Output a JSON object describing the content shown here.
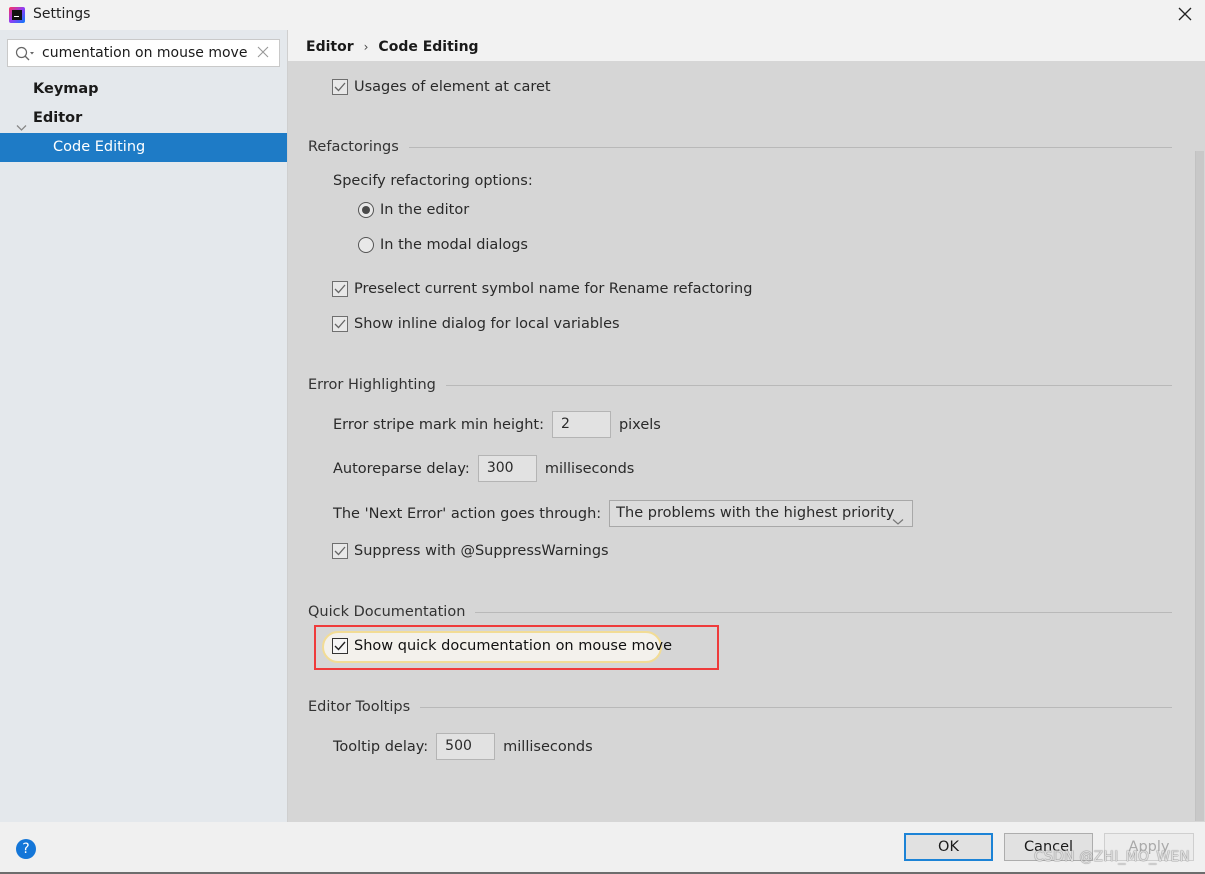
{
  "window": {
    "title": "Settings",
    "app_icon": "intellij-idea-icon",
    "close_icon": "close-icon"
  },
  "sidebar": {
    "search": {
      "value": "Show quick documentation on mouse move",
      "visible_text": "cumentation on mouse move",
      "icon": "search-icon",
      "clear_icon": "clear-icon"
    },
    "items": [
      {
        "label": "Keymap",
        "bold": true,
        "level": 0
      },
      {
        "label": "Editor",
        "bold": true,
        "level": 0,
        "expanded": true
      },
      {
        "label": "Code Editing",
        "bold": false,
        "level": 1,
        "selected": true
      }
    ]
  },
  "breadcrumb": {
    "parts": [
      "Editor",
      "Code Editing"
    ],
    "separator": "›"
  },
  "content": {
    "usages_checkbox": {
      "label": "Usages of element at caret",
      "checked": true
    },
    "refactorings": {
      "title": "Refactorings",
      "specify_label": "Specify refactoring options:",
      "radios": [
        {
          "label": "In the editor",
          "selected": true
        },
        {
          "label": "In the modal dialogs",
          "selected": false
        }
      ],
      "checkboxes": [
        {
          "label": "Preselect current symbol name for Rename refactoring",
          "checked": true
        },
        {
          "label": "Show inline dialog for local variables",
          "checked": true
        }
      ]
    },
    "error_highlighting": {
      "title": "Error Highlighting",
      "stripe": {
        "label": "Error stripe mark min height:",
        "value": "2",
        "unit": "pixels"
      },
      "autoreparse": {
        "label": "Autoreparse delay:",
        "value": "300",
        "unit": "milliseconds"
      },
      "next_error": {
        "label": "The 'Next Error' action goes through:",
        "selected": "The problems with the highest priority"
      },
      "suppress": {
        "label": "Suppress with @SuppressWarnings",
        "checked": true
      }
    },
    "quick_documentation": {
      "title": "Quick Documentation",
      "checkbox": {
        "label": "Show quick documentation on mouse move",
        "checked": true,
        "highlighted": true
      }
    },
    "editor_tooltips": {
      "title": "Editor Tooltips",
      "delay": {
        "label": "Tooltip delay:",
        "value": "500",
        "unit": "milliseconds"
      }
    }
  },
  "footer": {
    "help_label": "?",
    "ok_label": "OK",
    "cancel_label": "Cancel",
    "apply_label": "Apply",
    "apply_enabled": false
  },
  "watermark": "CSDN @ZHI_MO_WEN",
  "colors": {
    "selection": "#1e7bc6",
    "highlight_border": "#ef3b3b",
    "primary_button_border": "#1c83d6",
    "help_icon": "#1476d8"
  }
}
